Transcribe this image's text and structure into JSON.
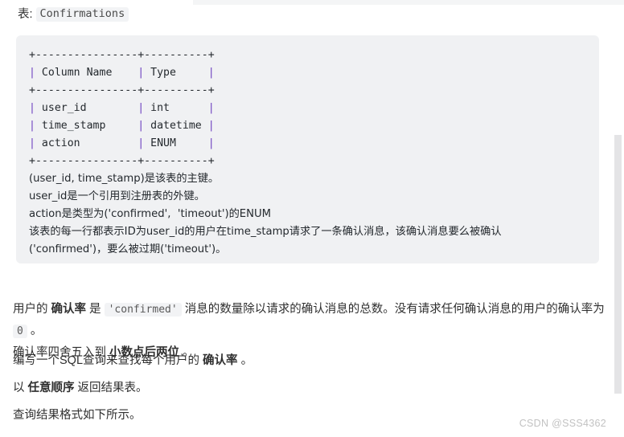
{
  "top_strip": {
    "present": true
  },
  "caption": {
    "label": "表:",
    "table_name": "Confirmations"
  },
  "code_block": {
    "lines": [
      "+----------------+----------+",
      "| Column Name    | Type     |",
      "+----------------+----------+",
      "| user_id        | int      |",
      "| time_stamp     | datetime |",
      "| action         | ENUM     |",
      "+----------------+----------+"
    ],
    "notes": [
      "(user_id, time_stamp)是该表的主键。",
      "user_id是一个引用到注册表的外键。",
      "action是类型为('confirmed',  'timeout')的ENUM",
      "该表的每一行都表示ID为user_id的用户在time_stamp请求了一条确认消息，该确认消息要么被确认",
      "('confirmed')，要么被过期('timeout')。"
    ]
  },
  "paragraphs": {
    "p1_a": "用户的 ",
    "p1_b": "确认率",
    "p1_c": " 是 ",
    "p1_code": "'confirmed'",
    "p1_d": " 消息的数量除以请求的确认消息的总数。没有请求任何确认消息的用户的确认率为 ",
    "p1_zero": "0",
    "p1_e": " 。",
    "p2_a": "确认率四舍五入到 ",
    "p2_b": "小数点后两位",
    "p2_c": " 。",
    "p3_a": "编写一个SQL查询来查找每个用户的 ",
    "p3_b": "确认率",
    "p3_c": " 。",
    "p4_a": "以 ",
    "p4_b": "任意顺序",
    "p4_c": " 返回结果表。",
    "p5": "查询结果格式如下所示。"
  },
  "watermark": {
    "text": "CSDN @SSS4362"
  },
  "colors": {
    "page_bg": "#ffffff",
    "code_bg": "#f0f1f3",
    "inline_code_bg": "#f2f3f5",
    "text": "#2f2f2f",
    "pipe_accent": "#6f42c1",
    "scrollbar_thumb": "#e4e4e6",
    "watermark": "#c2c2c2"
  }
}
